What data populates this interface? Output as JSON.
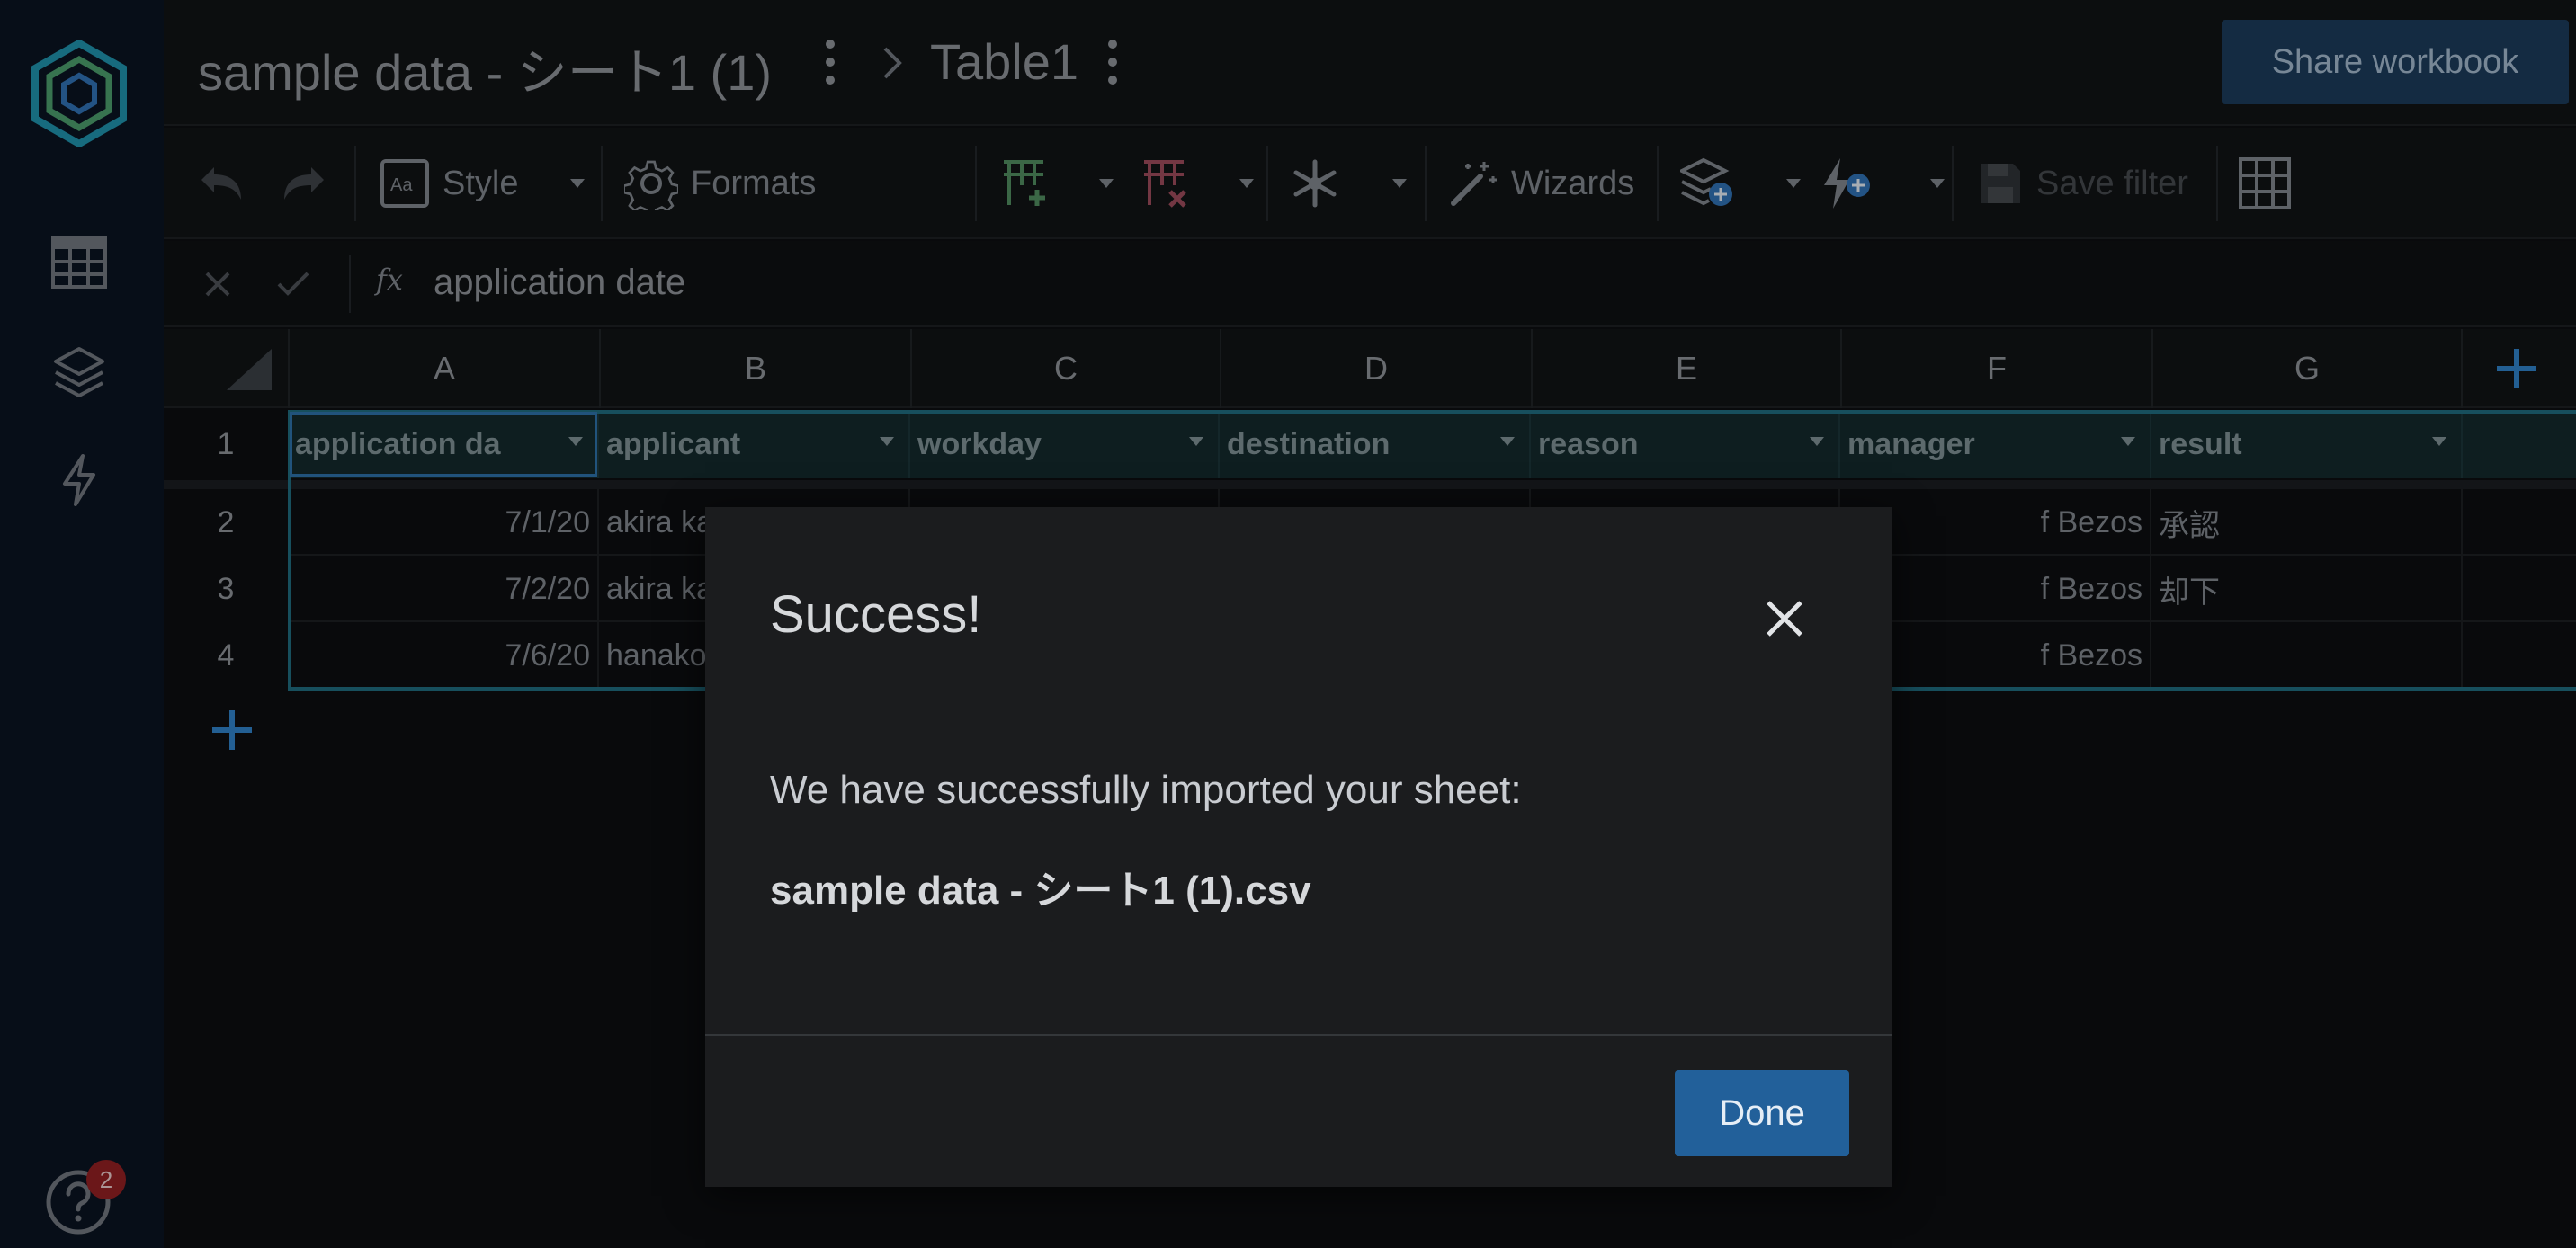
{
  "header": {
    "workbook_title": "sample data - シート1 (1)",
    "table_title": "Table1",
    "share_label": "Share workbook"
  },
  "toolbar": {
    "style_label": "Style",
    "formats_label": "Formats",
    "wizards_label": "Wizards",
    "save_filter_label": "Save filter"
  },
  "formula_bar": {
    "fx_label": "fx",
    "value": "application date"
  },
  "grid": {
    "column_letters": [
      "A",
      "B",
      "C",
      "D",
      "E",
      "F",
      "G"
    ],
    "row_numbers": [
      "1",
      "2",
      "3",
      "4"
    ],
    "header_row": [
      "application da",
      "applicant",
      "workday",
      "destination",
      "reason",
      "manager",
      "result"
    ],
    "rows": [
      {
        "date": "7/1/20",
        "applicant": "akira ka",
        "manager": "f Bezos",
        "result": "承認"
      },
      {
        "date": "7/2/20",
        "applicant": "akira ka",
        "manager": "f Bezos",
        "result": "却下"
      },
      {
        "date": "7/6/20",
        "applicant": "hanako",
        "manager": "f Bezos",
        "result": ""
      }
    ]
  },
  "sidebar": {
    "help_badge": "2"
  },
  "modal": {
    "title": "Success!",
    "message": "We have successfully imported your sheet:",
    "filename": "sample data - シート1 (1).csv",
    "done_label": "Done"
  },
  "colors": {
    "accent": "#22609a",
    "table_header_bg": "#13282b",
    "table_outline": "#1f6a7c",
    "badge": "#8f1f22"
  }
}
